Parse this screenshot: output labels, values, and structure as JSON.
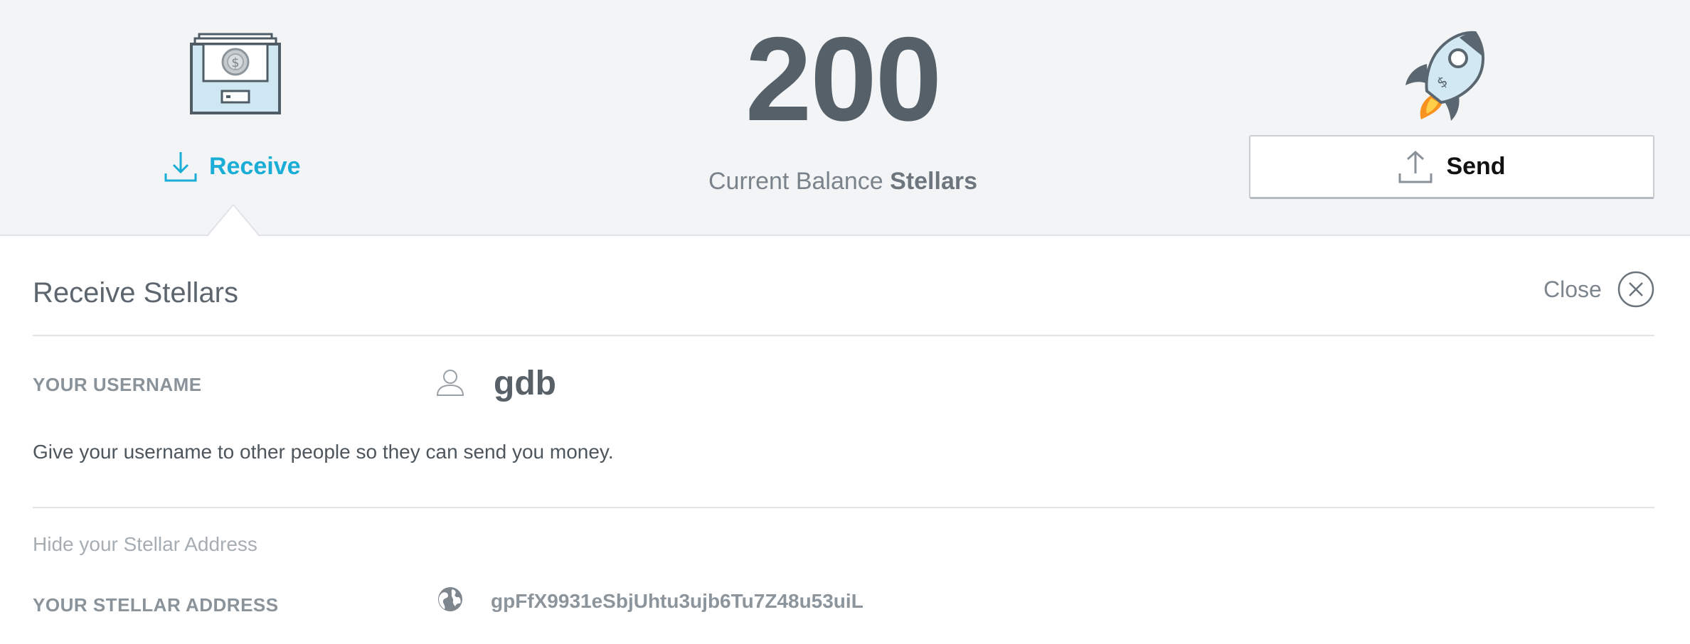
{
  "header": {
    "receive_label": "Receive",
    "balance_amount": "200",
    "balance_caption_prefix": "Current Balance",
    "balance_caption_currency": "Stellars",
    "send_label": "Send"
  },
  "panel": {
    "title": "Receive Stellars",
    "close_label": "Close",
    "username_label": "YOUR USERNAME",
    "username_value": "gdb",
    "username_help": "Give your username to other people so they can send you money.",
    "hide_address_link": "Hide your Stellar Address",
    "address_label": "YOUR STELLAR ADDRESS",
    "address_value": "gpFfX9931eSbjUhtu3ujb6Tu7Z48u53uiL"
  },
  "icons": {
    "drawer": "cash-drawer-icon",
    "receive": "download-icon",
    "rocket": "rocket-icon",
    "send": "upload-icon",
    "close": "close-circle-icon",
    "user": "user-icon",
    "globe": "globe-icon"
  },
  "colors": {
    "accent": "#1aaed6",
    "header_bg": "#f3f4f6",
    "balance_text": "#556069",
    "rocket_flame": "#f7931e"
  }
}
